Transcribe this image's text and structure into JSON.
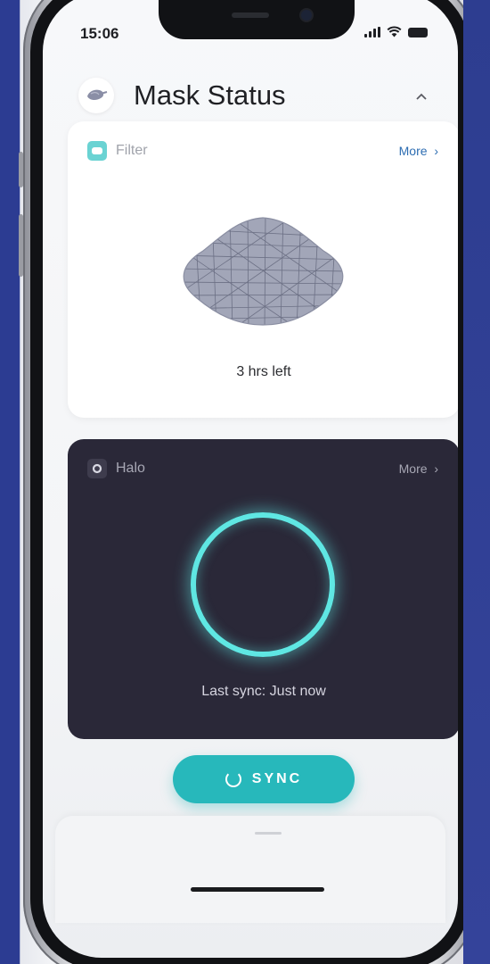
{
  "status_bar": {
    "time": "15:06"
  },
  "header": {
    "title": "Mask Status",
    "icon": "mask-icon",
    "chevron": "chevron-up-icon"
  },
  "filter_card": {
    "label": "Filter",
    "more_label": "More",
    "remaining": "3 hrs left",
    "icon": "filter-icon"
  },
  "halo_card": {
    "label": "Halo",
    "more_label": "More",
    "last_sync": "Last sync: Just now",
    "icon": "halo-icon",
    "ring_color": "#5fe7e3"
  },
  "sync_button": {
    "label": "SYNC",
    "color": "#27b8bb"
  }
}
